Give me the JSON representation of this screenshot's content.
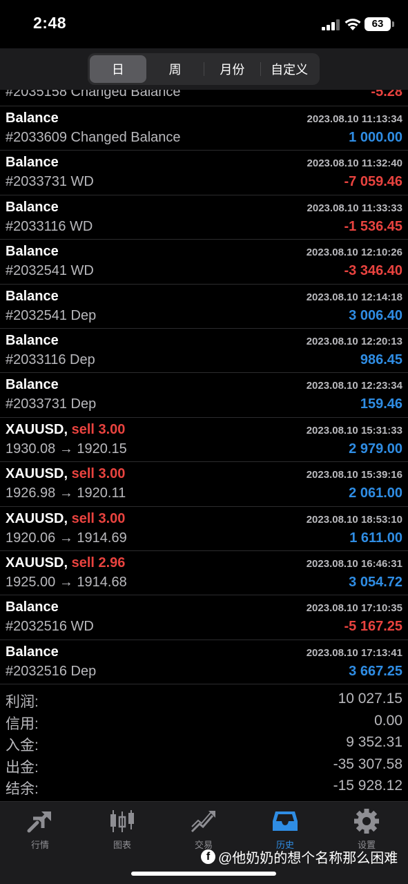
{
  "status": {
    "time": "2:48",
    "battery": "63"
  },
  "periods": [
    {
      "label": "日",
      "active": true
    },
    {
      "label": "周"
    },
    {
      "label": "月份"
    },
    {
      "label": "自定义"
    }
  ],
  "partial_row": {
    "sub": "#2035158 Changed Balance",
    "amount": "-5.28"
  },
  "deals": [
    {
      "title": "Balance",
      "side": "",
      "time": "2023.08.10 11:13:34",
      "sub": "#2033609 Changed Balance",
      "amount": "1 000.00",
      "sign": "pos"
    },
    {
      "title": "Balance",
      "side": "",
      "time": "2023.08.10 11:32:40",
      "sub": "#2033731 WD",
      "amount": "-7 059.46",
      "sign": "neg"
    },
    {
      "title": "Balance",
      "side": "",
      "time": "2023.08.10 11:33:33",
      "sub": "#2033116 WD",
      "amount": "-1 536.45",
      "sign": "neg"
    },
    {
      "title": "Balance",
      "side": "",
      "time": "2023.08.10 12:10:26",
      "sub": "#2032541 WD",
      "amount": "-3 346.40",
      "sign": "neg"
    },
    {
      "title": "Balance",
      "side": "",
      "time": "2023.08.10 12:14:18",
      "sub": "#2032541 Dep",
      "amount": "3 006.40",
      "sign": "pos"
    },
    {
      "title": "Balance",
      "side": "",
      "time": "2023.08.10 12:20:13",
      "sub": "#2033116 Dep",
      "amount": "986.45",
      "sign": "pos"
    },
    {
      "title": "Balance",
      "side": "",
      "time": "2023.08.10 12:23:34",
      "sub": "#2033731 Dep",
      "amount": "159.46",
      "sign": "pos"
    },
    {
      "title": "XAUUSD,",
      "side": "sell 3.00",
      "time": "2023.08.10 15:31:33",
      "sub": "1930.08 → 1920.15",
      "amount": "2 979.00",
      "sign": "pos"
    },
    {
      "title": "XAUUSD,",
      "side": "sell 3.00",
      "time": "2023.08.10 15:39:16",
      "sub": "1926.98 → 1920.11",
      "amount": "2 061.00",
      "sign": "pos"
    },
    {
      "title": "XAUUSD,",
      "side": "sell 3.00",
      "time": "2023.08.10 18:53:10",
      "sub": "1920.06 → 1914.69",
      "amount": "1 611.00",
      "sign": "pos"
    },
    {
      "title": "XAUUSD,",
      "side": "sell 2.96",
      "time": "2023.08.10 16:46:31",
      "sub": "1925.00 → 1914.68",
      "amount": "3 054.72",
      "sign": "pos"
    },
    {
      "title": "Balance",
      "side": "",
      "time": "2023.08.10 17:10:35",
      "sub": "#2032516 WD",
      "amount": "-5 167.25",
      "sign": "neg"
    },
    {
      "title": "Balance",
      "side": "",
      "time": "2023.08.10 17:13:41",
      "sub": "#2032516 Dep",
      "amount": "3 667.25",
      "sign": "pos"
    }
  ],
  "summary": [
    {
      "label": "利润:",
      "value": "10 027.15"
    },
    {
      "label": "信用:",
      "value": "0.00"
    },
    {
      "label": "入金:",
      "value": "9 352.31"
    },
    {
      "label": "出金:",
      "value": "-35 307.58"
    },
    {
      "label": "结余:",
      "value": "-15 928.12"
    }
  ],
  "tabs": [
    {
      "label": "行情",
      "icon": "quotes-icon",
      "active": false
    },
    {
      "label": "图表",
      "icon": "chart-icon",
      "active": false
    },
    {
      "label": "交易",
      "icon": "trade-icon",
      "active": false
    },
    {
      "label": "历史",
      "icon": "history-icon",
      "active": true
    },
    {
      "label": "设置",
      "icon": "settings-icon",
      "active": false
    }
  ],
  "watermark": "@他奶奶的想个名称那么困难",
  "colors": {
    "positive": "#2f8de4",
    "negative": "#e9433f",
    "active_tab": "#2f8de4"
  }
}
